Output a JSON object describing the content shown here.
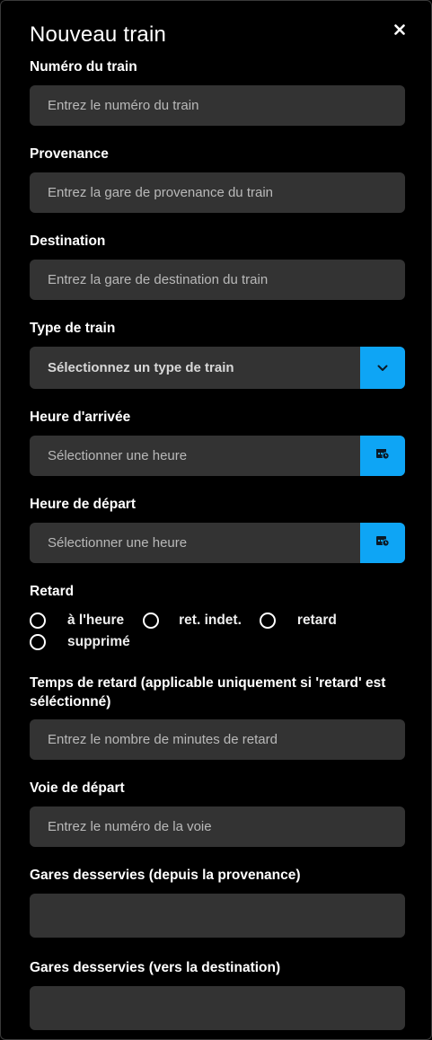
{
  "title": "Nouveau train",
  "fields": {
    "numero": {
      "label": "Numéro du train",
      "placeholder": "Entrez le numéro du train"
    },
    "provenance": {
      "label": "Provenance",
      "placeholder": "Entrez la gare de provenance du train"
    },
    "destination": {
      "label": "Destination",
      "placeholder": "Entrez la gare de destination du train"
    },
    "type": {
      "label": "Type de train",
      "selected": "Sélectionnez un type de train"
    },
    "arrivee": {
      "label": "Heure d'arrivée",
      "placeholder": "Sélectionner une heure"
    },
    "depart": {
      "label": "Heure de départ",
      "placeholder": "Sélectionner une heure"
    },
    "retard": {
      "label": "Retard",
      "options": [
        "à l'heure",
        "ret. indet.",
        "retard",
        "supprimé"
      ]
    },
    "temps_retard": {
      "label_line1": "Temps de retard (applicable uniquement si 'retard' est",
      "label_line2": "séléctionné)",
      "placeholder": "Entrez le nombre de minutes de retard"
    },
    "voie": {
      "label": "Voie de départ",
      "placeholder": "Entrez le numéro de la voie"
    },
    "gares_provenance": {
      "label": "Gares desservies (depuis la provenance)",
      "value": ""
    },
    "gares_destination": {
      "label": "Gares desservies (vers la destination)",
      "value": ""
    }
  },
  "colors": {
    "accent": "#0ea5f5",
    "field_bg": "#333333",
    "background": "#000000"
  },
  "icons": {
    "close": "close-icon",
    "dropdown": "chevron-down-icon",
    "time": "calendar-clock-icon"
  }
}
